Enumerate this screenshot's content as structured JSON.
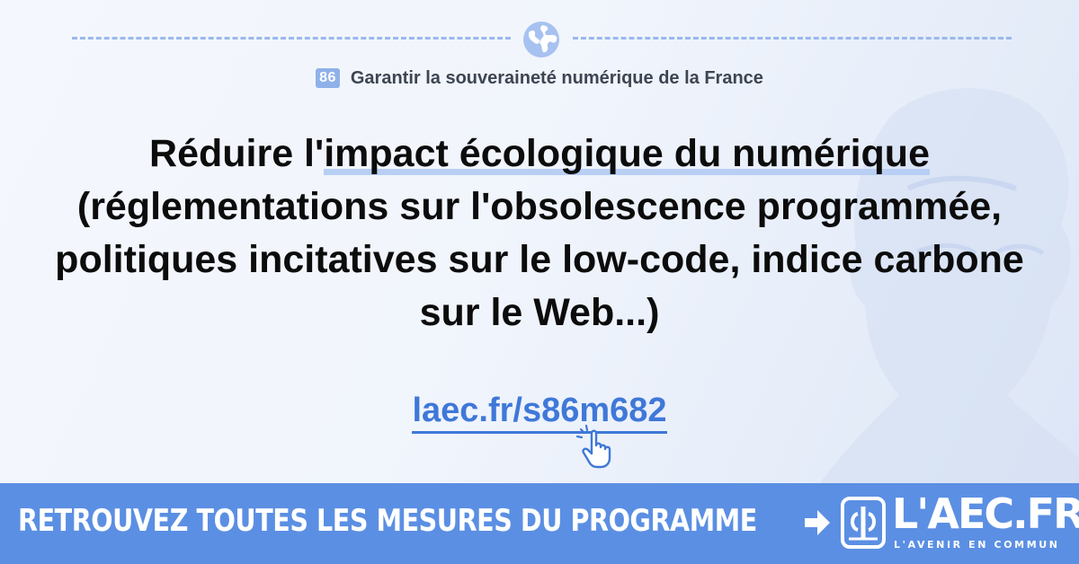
{
  "chapter": {
    "number": "86",
    "title": "Garantir la souveraineté numérique de la France"
  },
  "measure": {
    "headline_before": "Réduire l'",
    "headline_highlight": "impact écologique du numérique",
    "headline_after": " (réglementations sur l'obsolescence programmée, politiques incitatives sur le low-code, indice carbone sur le Web...)"
  },
  "short_link": "laec.fr/s86m682",
  "banner": {
    "text": "RETROUVEZ TOUTES LES MESURES DU PROGRAMME",
    "logo_text": "L'AEC.FR",
    "logo_subtitle": "L'AVENIR EN COMMUN"
  },
  "icons": {
    "globe": "globe-icon",
    "cursor": "pointer-hand-icon",
    "arrow": "arrow-right-icon",
    "logo": "phi-logo-icon"
  },
  "colors": {
    "accent": "#5b8fe3",
    "link": "#3f78d8",
    "highlight": "#b8cff3",
    "dash": "#9bb8ec"
  }
}
